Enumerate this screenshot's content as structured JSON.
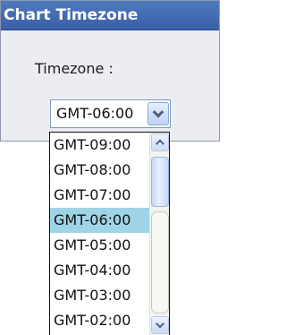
{
  "dialog": {
    "title": "Chart Timezone"
  },
  "timezone_field": {
    "label": "Timezone :",
    "selected_value": "GMT-06:00"
  },
  "dropdown": {
    "options": [
      "GMT-09:00",
      "GMT-08:00",
      "GMT-07:00",
      "GMT-06:00",
      "GMT-05:00",
      "GMT-04:00",
      "GMT-03:00",
      "GMT-02:00"
    ],
    "highlighted_option": "GMT-06:00"
  },
  "icons": {
    "select_button": "chevron-down-icon",
    "scroll_up": "chevron-up-icon",
    "scroll_down": "chevron-down-icon"
  },
  "colors": {
    "titlebar": "#3f67b1",
    "selection_highlight": "#9fd3e6"
  }
}
